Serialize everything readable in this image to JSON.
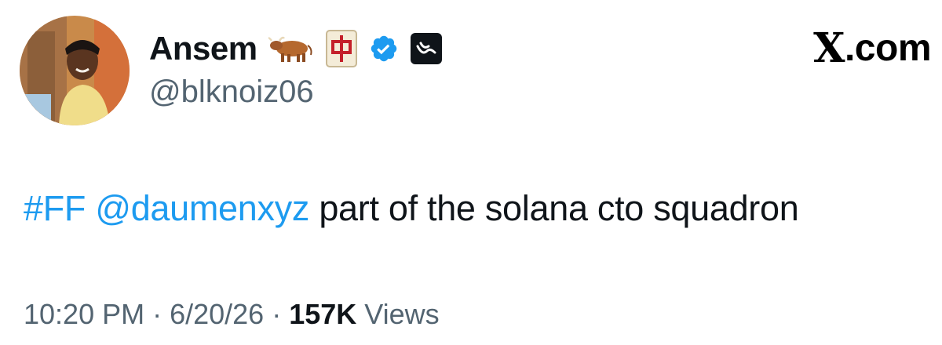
{
  "author": {
    "display_name": "Ansem",
    "handle": "@blknoiz06",
    "emoji_1": "ox-emoji",
    "emoji_2": "mahjong-red-dragon-emoji",
    "verified_badge": "verified-badge-icon",
    "affiliate_badge": "affiliate-badge-icon"
  },
  "brand": {
    "logo": "X",
    "label": ".com"
  },
  "tweet": {
    "hashtag": "#FF",
    "mention": "@daumenxyz",
    "text": " part of the solana cto squadron"
  },
  "meta": {
    "time": "10:20 PM",
    "separator_1": " · ",
    "date": "6/20/26",
    "separator_2": " · ",
    "views_count": "157K",
    "views_label": " Views"
  },
  "colors": {
    "link": "#1d9bf0",
    "text": "#0f1419",
    "secondary": "#536471",
    "verified": "#1d9bf0"
  }
}
